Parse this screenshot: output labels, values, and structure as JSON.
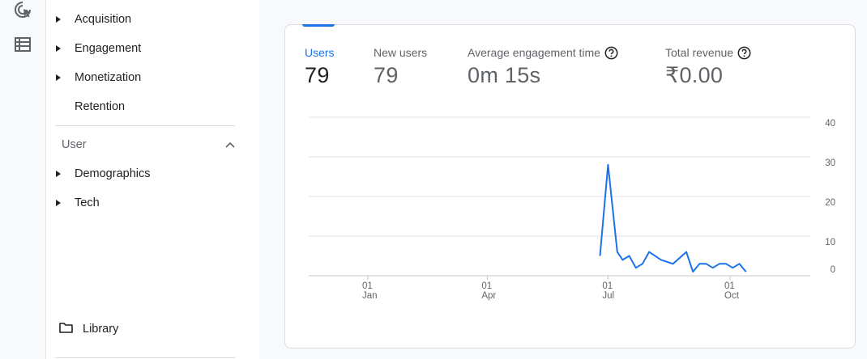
{
  "rail": {
    "icons": [
      {
        "name": "explore-cursor-icon"
      },
      {
        "name": "reports-list-icon"
      }
    ]
  },
  "nav": {
    "items": [
      {
        "label": "Acquisition",
        "expandable": true
      },
      {
        "label": "Engagement",
        "expandable": true
      },
      {
        "label": "Monetization",
        "expandable": true
      },
      {
        "label": "Retention",
        "expandable": false
      }
    ],
    "user_section": {
      "title": "User",
      "expanded": true,
      "items": [
        {
          "label": "Demographics",
          "expandable": true
        },
        {
          "label": "Tech",
          "expandable": true
        }
      ]
    },
    "library": {
      "label": "Library"
    }
  },
  "metrics": [
    {
      "label": "Users",
      "value": "79",
      "active": true,
      "help": false
    },
    {
      "label": "New users",
      "value": "79",
      "active": false,
      "help": false
    },
    {
      "label": "Average engagement time",
      "value": "0m 15s",
      "active": false,
      "help": true
    },
    {
      "label": "Total revenue",
      "value": "₹0.00",
      "active": false,
      "help": true
    }
  ],
  "colors": {
    "accent": "#1a73e8",
    "line": "#1a73e8",
    "grid": "#e0e0e0"
  },
  "chart_data": {
    "type": "line",
    "series": [
      {
        "values": [
          {
            "x": "2023-06-25",
            "y": 5
          },
          {
            "x": "2023-07-01",
            "y": 28
          },
          {
            "x": "2023-07-08",
            "y": 6
          },
          {
            "x": "2023-07-12",
            "y": 4
          },
          {
            "x": "2023-07-17",
            "y": 5
          },
          {
            "x": "2023-07-22",
            "y": 2
          },
          {
            "x": "2023-07-27",
            "y": 3
          },
          {
            "x": "2023-08-01",
            "y": 6
          },
          {
            "x": "2023-08-10",
            "y": 4
          },
          {
            "x": "2023-08-19",
            "y": 3
          },
          {
            "x": "2023-08-29",
            "y": 6
          },
          {
            "x": "2023-09-03",
            "y": 1
          },
          {
            "x": "2023-09-08",
            "y": 3
          },
          {
            "x": "2023-09-13",
            "y": 3
          },
          {
            "x": "2023-09-18",
            "y": 2
          },
          {
            "x": "2023-09-23",
            "y": 3
          },
          {
            "x": "2023-09-28",
            "y": 3
          },
          {
            "x": "2023-10-03",
            "y": 2
          },
          {
            "x": "2023-10-08",
            "y": 3
          },
          {
            "x": "2023-10-13",
            "y": 1
          }
        ]
      }
    ],
    "x_ticks": [
      {
        "day": "01",
        "month": "Jan",
        "date": "2023-01-01"
      },
      {
        "day": "01",
        "month": "Apr",
        "date": "2023-04-01"
      },
      {
        "day": "01",
        "month": "Jul",
        "date": "2023-07-01"
      },
      {
        "day": "01",
        "month": "Oct",
        "date": "2023-10-01"
      }
    ],
    "y_ticks": [
      40,
      30,
      20,
      10,
      0
    ],
    "ylim": [
      0,
      40
    ],
    "grid": true
  }
}
